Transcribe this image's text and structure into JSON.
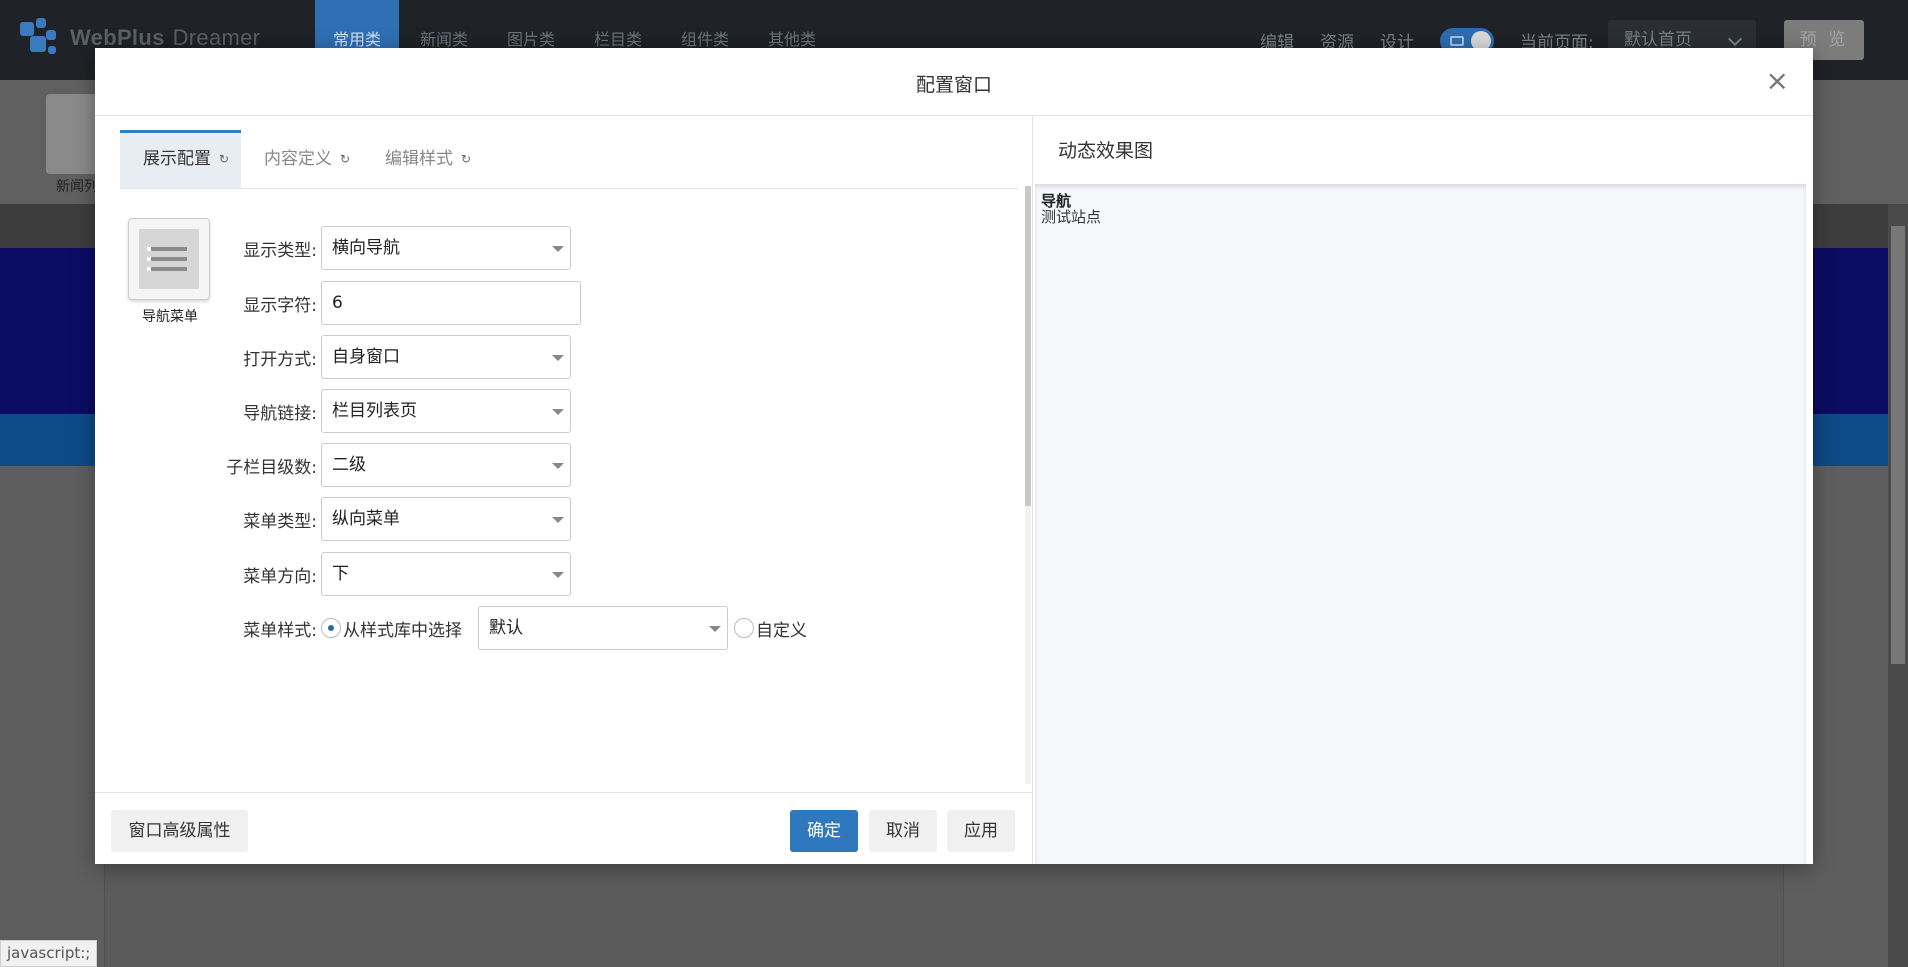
{
  "app": {
    "logo_text": "WebPlus",
    "logo_sub": "Dreamer",
    "main_tabs": [
      "常用类",
      "新闻类",
      "图片类",
      "栏目类",
      "组件类",
      "其他类"
    ],
    "right_links": [
      "编辑",
      "资源",
      "设计"
    ],
    "current_page_label": "当前页面:",
    "current_page_value": "默认首页",
    "preview_button": "预 览",
    "toolbar_item_label": "新闻列",
    "status_url": "javascript:;"
  },
  "modal": {
    "title": "配置窗口",
    "close_glyph": "×",
    "tabs": [
      {
        "label": "展示配置",
        "refresh": "↻"
      },
      {
        "label": "内容定义",
        "refresh": "↻"
      },
      {
        "label": "编辑样式",
        "refresh": "↻"
      }
    ],
    "component_label": "导航菜单",
    "fields": {
      "display_type": {
        "label": "显示类型:",
        "value": "横向导航"
      },
      "display_chars": {
        "label": "显示字符:",
        "value": "6"
      },
      "open_mode": {
        "label": "打开方式:",
        "value": "自身窗口"
      },
      "nav_link": {
        "label": "导航链接:",
        "value": "栏目列表页"
      },
      "sub_levels": {
        "label": "子栏目级数:",
        "value": "二级"
      },
      "menu_type": {
        "label": "菜单类型:",
        "value": "纵向菜单"
      },
      "menu_direction": {
        "label": "菜单方向:",
        "value": "下"
      },
      "menu_style": {
        "label": "菜单样式:",
        "option_library": "从样式库中选择",
        "library_value": "默认",
        "option_custom": "自定义"
      }
    },
    "buttons": {
      "advanced": "窗口高级属性",
      "ok": "确定",
      "cancel": "取消",
      "apply": "应用"
    },
    "preview": {
      "title": "动态效果图",
      "nav_text": "导航",
      "site_text": "测试站点"
    }
  }
}
